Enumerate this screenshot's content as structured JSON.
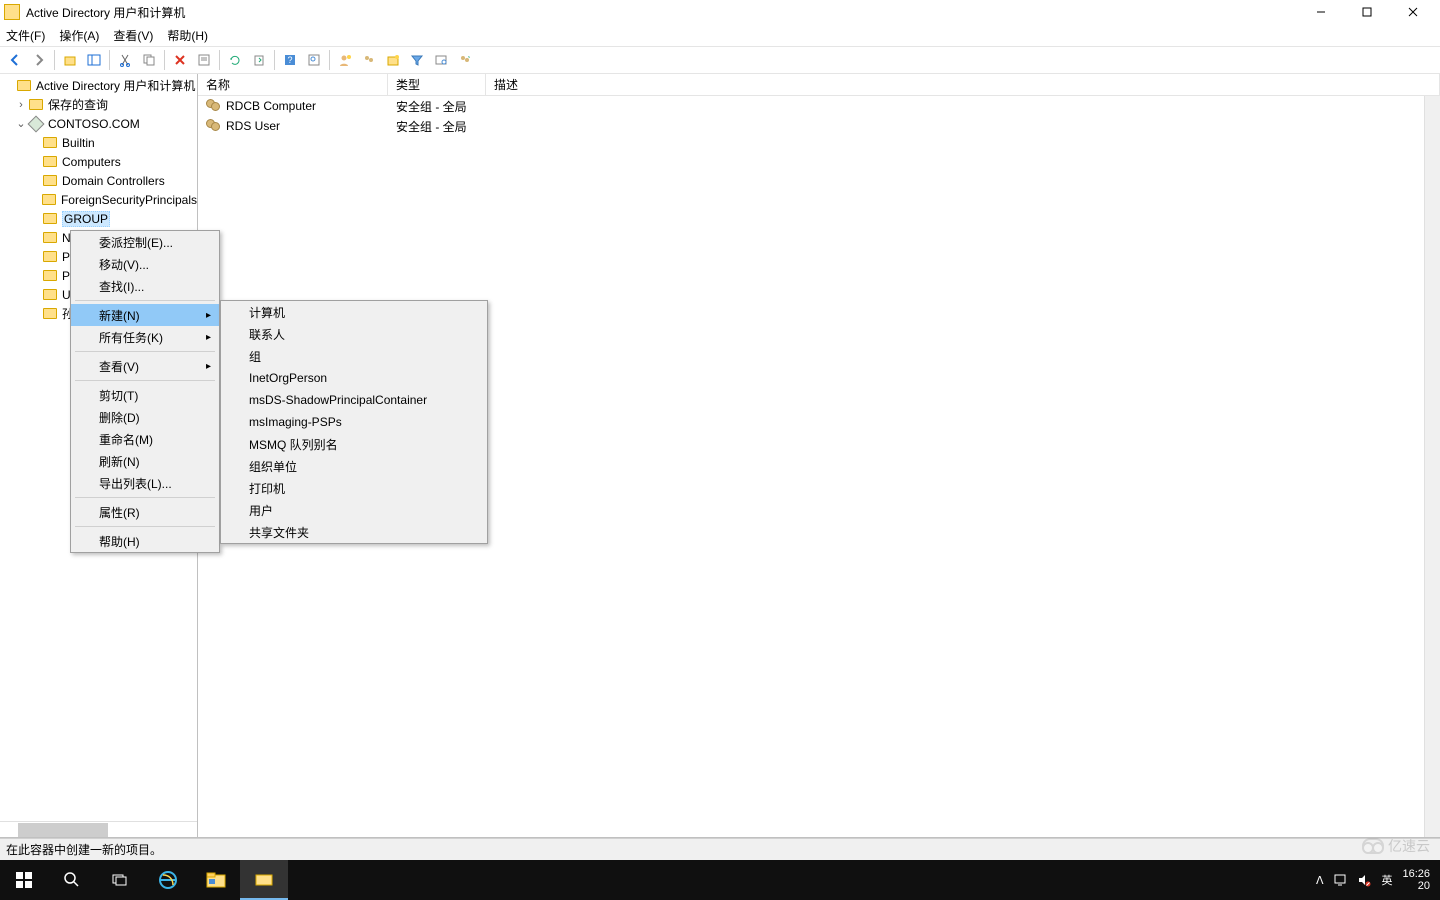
{
  "title": "Active Directory 用户和计算机",
  "menubar": [
    "文件(F)",
    "操作(A)",
    "查看(V)",
    "帮助(H)"
  ],
  "tree": {
    "root": "Active Directory 用户和计算机",
    "saved_queries": "保存的查询",
    "domain": "CONTOSO.COM",
    "children": [
      "Builtin",
      "Computers",
      "Domain Controllers",
      "ForeignSecurityPrincipals",
      "GROUP"
    ],
    "partial": [
      "N",
      "P",
      "P",
      "U",
      "孙"
    ]
  },
  "list": {
    "headers": {
      "name": "名称",
      "type": "类型",
      "desc": "描述"
    },
    "rows": [
      {
        "name": "RDCB Computer",
        "type": "安全组 - 全局"
      },
      {
        "name": "RDS User",
        "type": "安全组 - 全局"
      }
    ]
  },
  "ctx1": {
    "delegate": "委派控制(E)...",
    "move": "移动(V)...",
    "find": "查找(I)...",
    "new": "新建(N)",
    "all_tasks": "所有任务(K)",
    "view": "查看(V)",
    "cut": "剪切(T)",
    "delete": "删除(D)",
    "rename": "重命名(M)",
    "refresh": "刷新(N)",
    "export": "导出列表(L)...",
    "props": "属性(R)",
    "help": "帮助(H)"
  },
  "ctx2": [
    "计算机",
    "联系人",
    "组",
    "InetOrgPerson",
    "msDS-ShadowPrincipalContainer",
    "msImaging-PSPs",
    "MSMQ 队列别名",
    "组织单位",
    "打印机",
    "用户",
    "共享文件夹"
  ],
  "status": "在此容器中创建一新的项目。",
  "tray": {
    "ime": "英",
    "time": "16:26",
    "date_partial": "20"
  },
  "watermark": "亿速云"
}
